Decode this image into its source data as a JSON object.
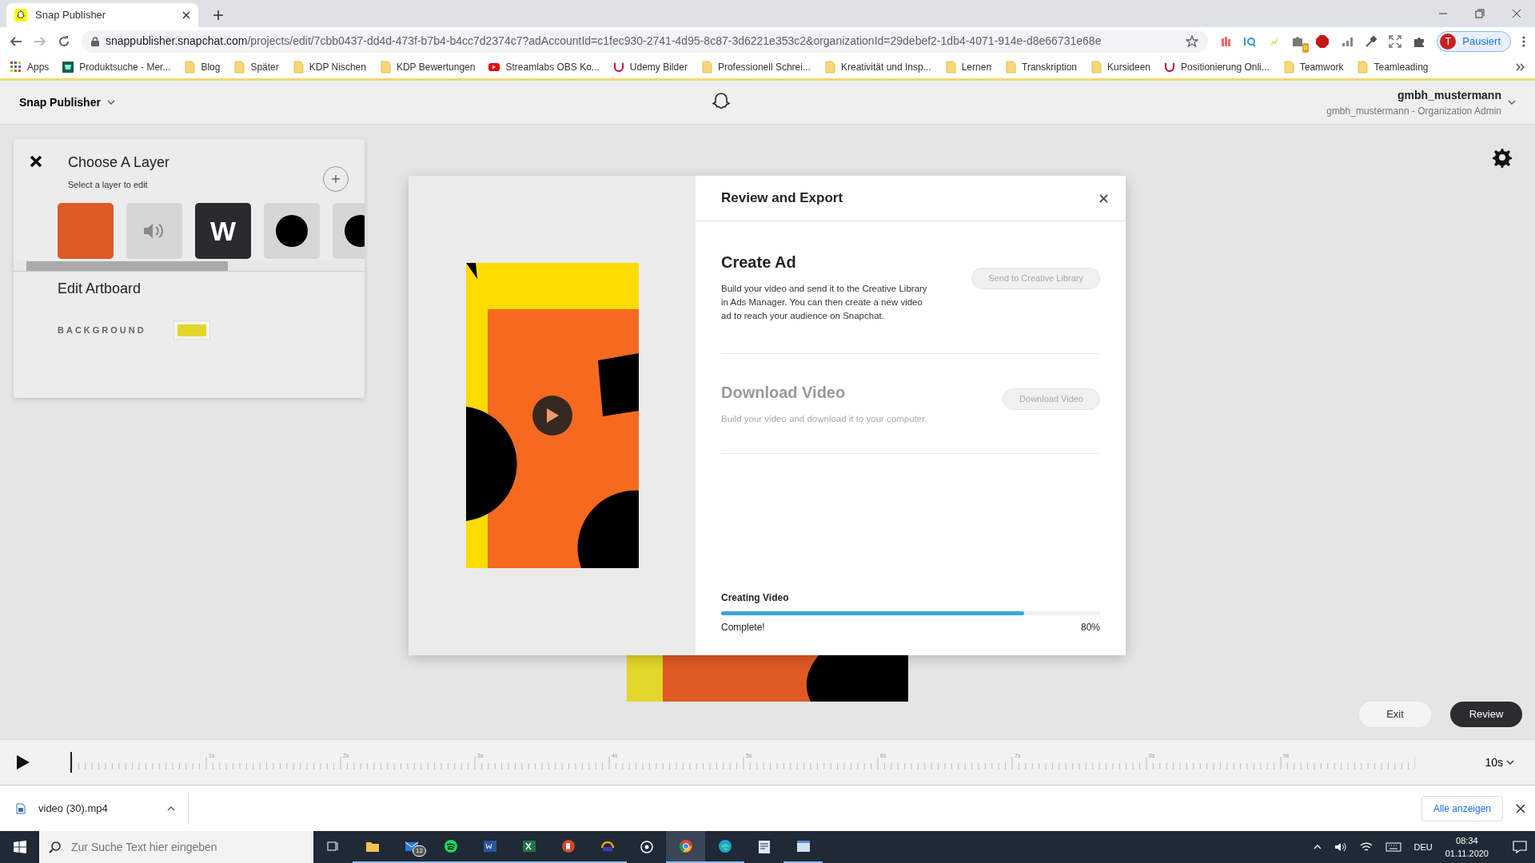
{
  "browser": {
    "tab_title": "Snap Publisher",
    "url_host": "snappublisher.snapchat.com",
    "url_path": "/projects/edit/7cbb0437-dd4d-473f-b7b4-b4cc7d2374c7?adAccountId=c1fec930-2741-4d95-8c87-3d6221e353c2&organizationId=29debef2-1db4-4071-914e-d8e66731e68e",
    "extension_badge": "0",
    "profile_initial": "T",
    "profile_label": "Pausiert",
    "bookmarks": [
      {
        "kind": "apps",
        "label": "Apps"
      },
      {
        "kind": "shop",
        "label": "Produktsuche - Mer..."
      },
      {
        "kind": "folder",
        "label": "Blog"
      },
      {
        "kind": "folder",
        "label": "Später"
      },
      {
        "kind": "folder",
        "label": "KDP Nischen"
      },
      {
        "kind": "folder",
        "label": "KDP Bewertungen"
      },
      {
        "kind": "video",
        "label": "Streamlabs OBS Ko..."
      },
      {
        "kind": "udemy",
        "label": "Udemy Bilder"
      },
      {
        "kind": "folder",
        "label": "Professionell Schrei..."
      },
      {
        "kind": "folder",
        "label": "Kreativität und Insp..."
      },
      {
        "kind": "folder",
        "label": "Lernen"
      },
      {
        "kind": "folder",
        "label": "Transkription"
      },
      {
        "kind": "folder",
        "label": "Kursideen"
      },
      {
        "kind": "udemy",
        "label": "Positionierung Onli..."
      },
      {
        "kind": "folder",
        "label": "Teamwork"
      },
      {
        "kind": "folder",
        "label": "Teamleading"
      }
    ]
  },
  "app_header": {
    "brand": "Snap Publisher",
    "user_name": "gmbh_mustermann",
    "user_role": "gmbh_mustermann - Organization Admin"
  },
  "layer_panel": {
    "title": "Choose A Layer",
    "subtitle": "Select a layer to edit",
    "layers": [
      {
        "kind": "color"
      },
      {
        "kind": "audio"
      },
      {
        "kind": "text",
        "letter": "W"
      },
      {
        "kind": "shape"
      },
      {
        "kind": "shape"
      }
    ],
    "section_title": "Edit Artboard",
    "background_label": "BACKGROUND"
  },
  "modal": {
    "title": "Review and Export",
    "sections": [
      {
        "title": "Create Ad",
        "text": "Build your video and send it to the Creative Library in Ads Manager. You can then create a new video ad to reach your audience on Snapchat.",
        "button": "Send to Creative Library",
        "disabled": false,
        "button_disabled": true
      },
      {
        "title": "Download Video",
        "text": "Build your video and download it to your computer.",
        "button": "Download Video",
        "disabled": true,
        "button_disabled": true
      }
    ],
    "progress": {
      "label": "Creating Video",
      "level": 0.8,
      "status": "Complete!",
      "percent": "80%"
    }
  },
  "actions": [
    {
      "label": "Exit",
      "kind": "secondary"
    },
    {
      "label": "Review",
      "kind": "primary"
    }
  ],
  "timeline": {
    "ticks": [
      "1s",
      "2s",
      "3s",
      "4s",
      "5s",
      "6s",
      "7s",
      "8s",
      "9s"
    ],
    "duration": "10s"
  },
  "download_bar": {
    "file": "video (30).mp4",
    "show_all": "Alle anzeigen"
  },
  "taskbar": {
    "search_placeholder": "Zur Suche Text hier eingeben",
    "mail_badge": "12",
    "language": "DEU",
    "time": "08:34",
    "date": "01.11.2020"
  }
}
